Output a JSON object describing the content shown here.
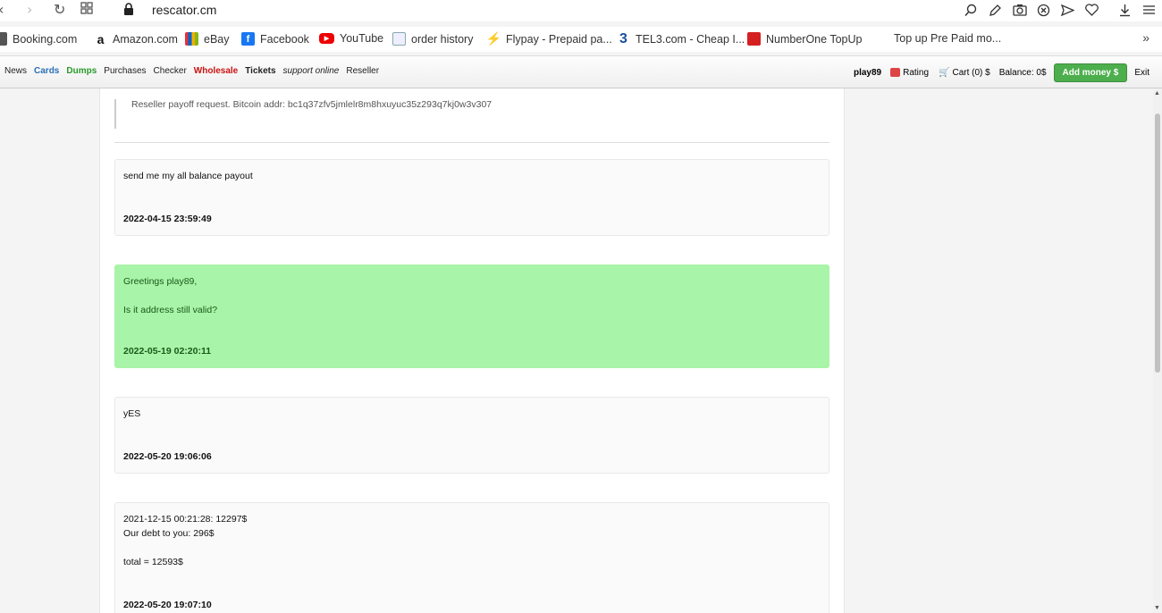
{
  "browser": {
    "url": "rescator.cm",
    "back_icon": "chevron-left-icon",
    "forward_icon": "chevron-right-icon",
    "reload_icon": "reload-icon"
  },
  "bookmarks": [
    {
      "label": "Booking.com",
      "icon": "document-icon"
    },
    {
      "label": "Amazon.com",
      "icon": "amazon-icon"
    },
    {
      "label": "eBay",
      "icon": "ebay-icon"
    },
    {
      "label": "Facebook",
      "icon": "facebook-icon"
    },
    {
      "label": "YouTube",
      "icon": "youtube-icon"
    },
    {
      "label": "order history",
      "icon": "document-icon"
    },
    {
      "label": "Flypay - Prepaid pa...",
      "icon": "lightning-icon"
    },
    {
      "label": "TEL3.com - Cheap I...",
      "icon": "tel3-icon"
    },
    {
      "label": "NumberOne TopUp",
      "icon": "numberone-icon"
    },
    {
      "label": "Top up Pre Paid mo...",
      "icon": ""
    }
  ],
  "site_nav": {
    "items": [
      "News",
      "Cards",
      "Dumps",
      "Purchases",
      "Checker",
      "Wholesale",
      "Tickets",
      "support online",
      "Reseller"
    ],
    "username": "play89",
    "rating": "Rating",
    "cart": "Cart (0) $",
    "balance": "Balance: 0$",
    "add_money": "Add money $",
    "exit": "Exit",
    "colors": {
      "cards": "#2a6fb5",
      "dumps": "#2a9a2a",
      "wholesale": "#cc1111"
    }
  },
  "ticket": {
    "quote": "Reseller payoff request. Bitcoin addr: bc1q37zfv5jmlelr8m8hxuyuc35z293q7kj0w3v307",
    "messages": [
      {
        "lines": [
          "send me my all balance payout"
        ],
        "date": "2022-04-15 23:59:49",
        "admin": false
      },
      {
        "lines": [
          "Greetings play89,",
          "",
          "Is it address still valid?"
        ],
        "date": "2022-05-19 02:20:11",
        "admin": true
      },
      {
        "lines": [
          "yES"
        ],
        "date": "2022-05-20 19:06:06",
        "admin": false
      },
      {
        "lines": [
          "2021-12-15 00:21:28: 12297$",
          "Our debt to you: 296$",
          "",
          "total = 12593$"
        ],
        "date": "2022-05-20 19:07:10",
        "admin": false
      }
    ]
  }
}
